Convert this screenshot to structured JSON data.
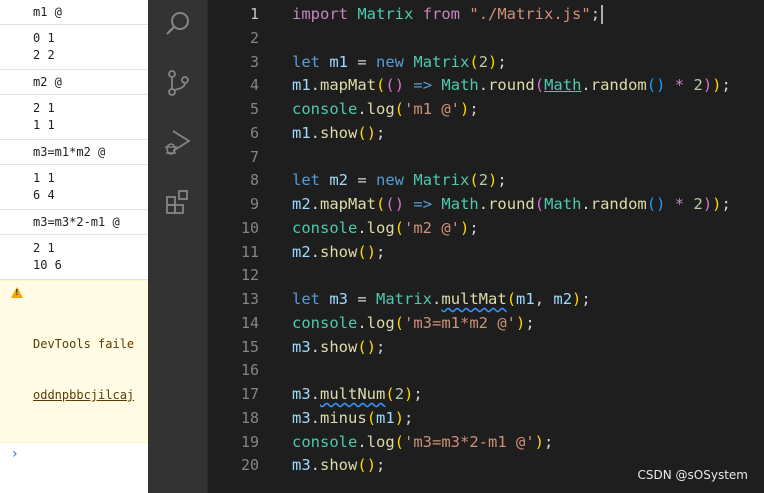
{
  "console": {
    "messages": [
      {
        "label": "m1 @",
        "rows": [
          "0 1",
          "2 2"
        ]
      },
      {
        "label": "m2 @",
        "rows": [
          "2 1",
          "1 1"
        ]
      },
      {
        "label": "m3=m1*m2 @",
        "rows": [
          "1 1",
          "6 4"
        ]
      },
      {
        "label": "m3=m3*2-m1 @",
        "rows": [
          "2 1",
          "10 6"
        ]
      }
    ],
    "warning": {
      "line1": "DevTools faile",
      "line2": "oddnpbbcjilcaj"
    },
    "prompt_symbol": "›"
  },
  "activity_bar": {
    "icons": [
      "search-icon",
      "source-control-icon",
      "run-debug-icon",
      "extensions-icon"
    ]
  },
  "editor": {
    "active_line": 1,
    "line_numbers": [
      "1",
      "2",
      "3",
      "4",
      "5",
      "6",
      "7",
      "8",
      "9",
      "10",
      "11",
      "12",
      "13",
      "14",
      "15",
      "16",
      "17",
      "18",
      "19",
      "20"
    ],
    "lines": [
      "import Matrix from \"./Matrix.js\";",
      "",
      "let m1 = new Matrix(2);",
      "m1.mapMat(() => Math.round(Math.random() * 2));",
      "console.log('m1 @');",
      "m1.show();",
      "",
      "let m2 = new Matrix(2);",
      "m2.mapMat(() => Math.round(Math.random() * 2));",
      "console.log('m2 @');",
      "m2.show();",
      "",
      "let m3 = Matrix.multMat(m1, m2);",
      "console.log('m3=m1*m2 @');",
      "m3.show();",
      "",
      "m3.multNum(2);",
      "m3.minus(m1);",
      "console.log('m3=m3*2-m1 @');",
      "m3.show();"
    ]
  },
  "watermark": "CSDN @sOSystem"
}
